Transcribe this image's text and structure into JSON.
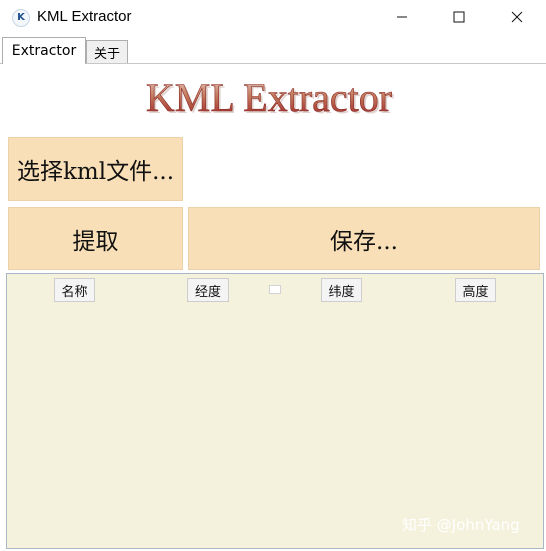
{
  "window": {
    "icon_letter": "K",
    "title": "KML Extractor"
  },
  "tabs": [
    {
      "label": "Extractor",
      "active": true
    },
    {
      "label": "关于",
      "active": false
    }
  ],
  "logo": {
    "text": "KML Extractor",
    "colors": {
      "fill_top": "#e9d3cf",
      "fill_bottom": "#9b1f24",
      "accent": "#c57c5e"
    }
  },
  "buttons": {
    "select_file": "选择kml文件...",
    "extract": "提取",
    "save": "保存...",
    "color": "#f8dfb7"
  },
  "table": {
    "background": "#f4f2dc",
    "columns": [
      {
        "label": "名称"
      },
      {
        "label": "经度"
      },
      {
        "label": "纬度"
      },
      {
        "label": "高度"
      }
    ],
    "rows": []
  },
  "watermark": "知乎 @JohnYang"
}
